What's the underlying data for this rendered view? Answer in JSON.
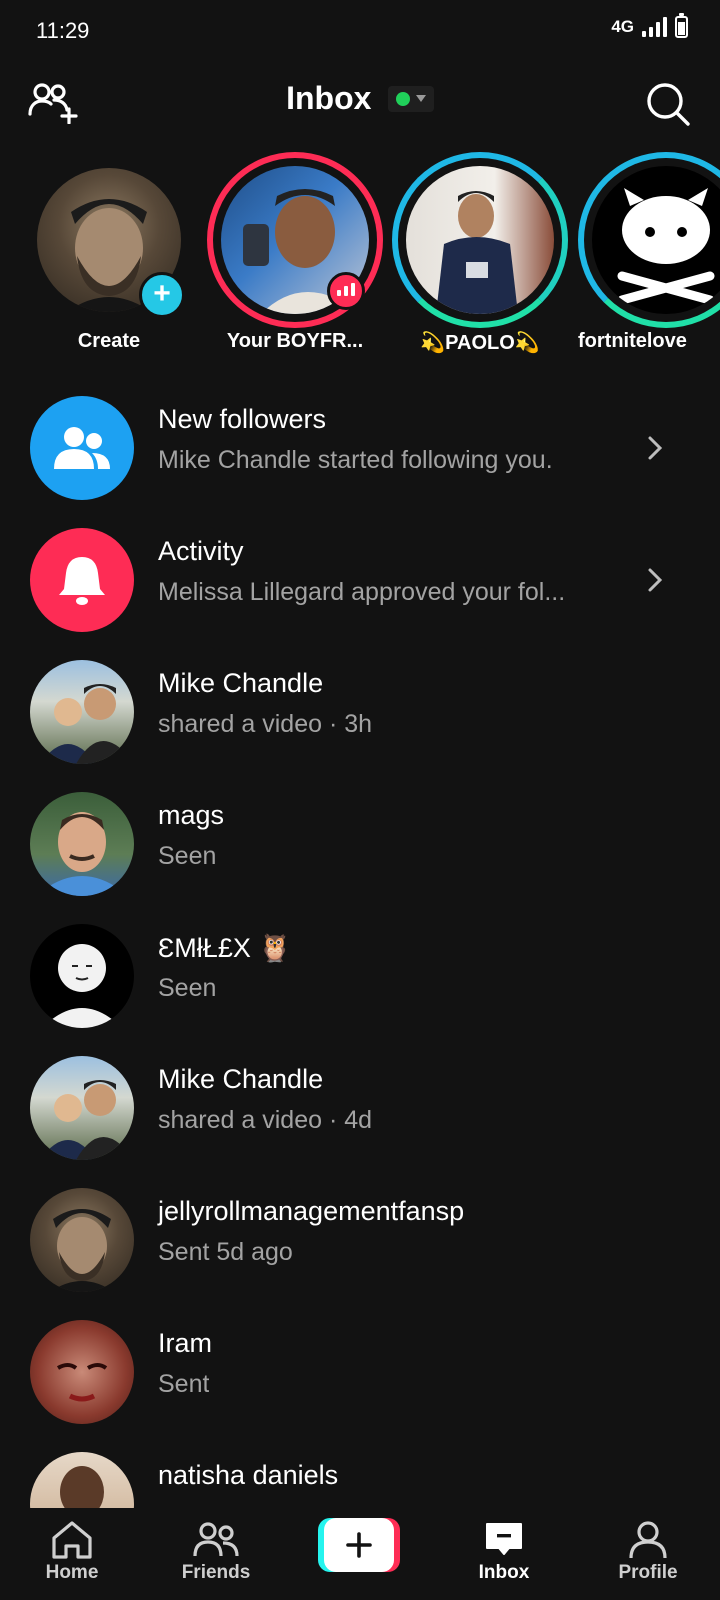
{
  "status_bar": {
    "time": "11:29",
    "network": "4G"
  },
  "header": {
    "title": "Inbox"
  },
  "stories": [
    {
      "label": "Create"
    },
    {
      "label": "Your BOYFR..."
    },
    {
      "label": "💫PAOLO💫"
    },
    {
      "label": "fortnitelove"
    }
  ],
  "inbox": [
    {
      "title": "New followers",
      "subtitle": "Mike Chandle started following you."
    },
    {
      "title": "Activity",
      "subtitle": "Melissa Lillegard approved your fol..."
    },
    {
      "title": "Mike Chandle",
      "subtitle": "shared a video · 3h"
    },
    {
      "title": "mags",
      "subtitle": "Seen"
    },
    {
      "title": "ƐMłŁ£X 🦉",
      "subtitle": "Seen"
    },
    {
      "title": "Mike Chandle",
      "subtitle": "shared a video · 4d"
    },
    {
      "title": "jellyrollmanagementfansp",
      "subtitle": "Sent 5d ago"
    },
    {
      "title": "Iram",
      "subtitle": "Sent"
    },
    {
      "title": "natisha daniels",
      "subtitle": ""
    }
  ],
  "nav": {
    "home": "Home",
    "friends": "Friends",
    "inbox": "Inbox",
    "profile": "Profile"
  },
  "colors": {
    "background": "#121212",
    "accent_pink": "#fe2c55",
    "accent_cyan": "#25c8e6",
    "followers_blue": "#1da1f2",
    "online_green": "#20d05a"
  },
  "icons": {
    "add_friends": "add-user-icon",
    "search": "search-icon",
    "followers": "people-icon",
    "activity": "bell-icon"
  }
}
